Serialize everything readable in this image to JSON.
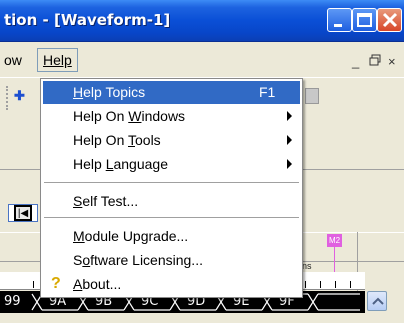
{
  "window": {
    "title": "tion - [Waveform-1]"
  },
  "menubar": {
    "view_fragment": "ow",
    "help_label": "Help",
    "mdi_min": "_",
    "mdi_restore": "▫",
    "mdi_close": "×"
  },
  "help_menu": {
    "items": [
      {
        "pre": "",
        "ul": "H",
        "post": "elp Topics",
        "shortcut": "F1",
        "submenu": false,
        "highlighted": true
      },
      {
        "pre": "Help On ",
        "ul": "W",
        "post": "indows",
        "shortcut": "",
        "submenu": true
      },
      {
        "pre": "Help On ",
        "ul": "T",
        "post": "ools",
        "shortcut": "",
        "submenu": true
      },
      {
        "pre": "Help ",
        "ul": "L",
        "post": "anguage",
        "shortcut": "",
        "submenu": true
      },
      {
        "pre": "",
        "ul": "S",
        "post": "elf Test...",
        "shortcut": "",
        "submenu": false
      },
      {
        "pre": "",
        "ul": "M",
        "post": "odule Upgrade...",
        "shortcut": "",
        "submenu": false
      },
      {
        "pre": "S",
        "ul": "o",
        "post": "ftware Licensing...",
        "shortcut": "",
        "submenu": false
      },
      {
        "pre": "",
        "ul": "A",
        "post": "bout...",
        "shortcut": "",
        "submenu": false
      }
    ]
  },
  "waveform": {
    "marker_label": "M2",
    "units_fragment": "ns",
    "bus_values": [
      "99",
      "9A",
      "9B",
      "9C",
      "9D",
      "9E",
      "9F"
    ]
  },
  "colors": {
    "highlight": "#316ac5",
    "marker": "#e060e0"
  }
}
